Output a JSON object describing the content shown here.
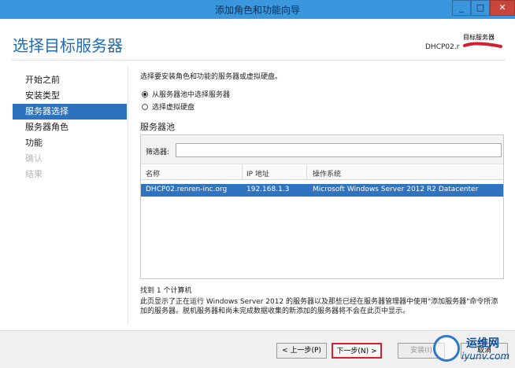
{
  "window": {
    "title": "添加角色和功能向导",
    "min_glyph": "_",
    "max_glyph": "□",
    "close_glyph": "✕"
  },
  "header": {
    "page_title": "选择目标服务器",
    "dest_label": "目标服务器",
    "dest_server": "DHCP02.r"
  },
  "nav": {
    "items": [
      {
        "label": "开始之前",
        "state": "normal"
      },
      {
        "label": "安装类型",
        "state": "normal"
      },
      {
        "label": "服务器选择",
        "state": "active"
      },
      {
        "label": "服务器角色",
        "state": "normal"
      },
      {
        "label": "功能",
        "state": "normal"
      },
      {
        "label": "确认",
        "state": "disabled"
      },
      {
        "label": "结果",
        "state": "disabled"
      }
    ]
  },
  "main": {
    "intro": "选择要安装角色和功能的服务器或虚拟硬盘。",
    "radio_pool": "从服务器池中选择服务器",
    "radio_vhd": "选择虚拟硬盘",
    "pool_label": "服务器池",
    "filter_label": "筛选器:",
    "filter_value": "",
    "columns": [
      "名称",
      "IP 地址",
      "操作系统"
    ],
    "rows": [
      {
        "name": "DHCP02.renren-inc.org",
        "ip": "192.168.1.3",
        "os": "Microsoft Windows Server 2012 R2 Datacenter"
      }
    ],
    "found_count": "找到 1 个计算机",
    "description": "此页显示了正在运行 Windows Server 2012 的服务器以及那些已经在服务器管理器中使用\"添加服务器\"命令所添加的服务器。脱机服务器和尚未完成数据收集的新添加的服务器将不会在此页中显示。"
  },
  "footer": {
    "prev": "< 上一步(P)",
    "next": "下一步(N) >",
    "install": "安装(I)",
    "cancel": "取消"
  },
  "watermark": {
    "text1": "运维网",
    "text2": "iyunv.com"
  },
  "colors": {
    "accent": "#2c72bf",
    "titlebar": "#3a96dd",
    "close": "#c7453a",
    "highlight_red": "#d2202e"
  }
}
